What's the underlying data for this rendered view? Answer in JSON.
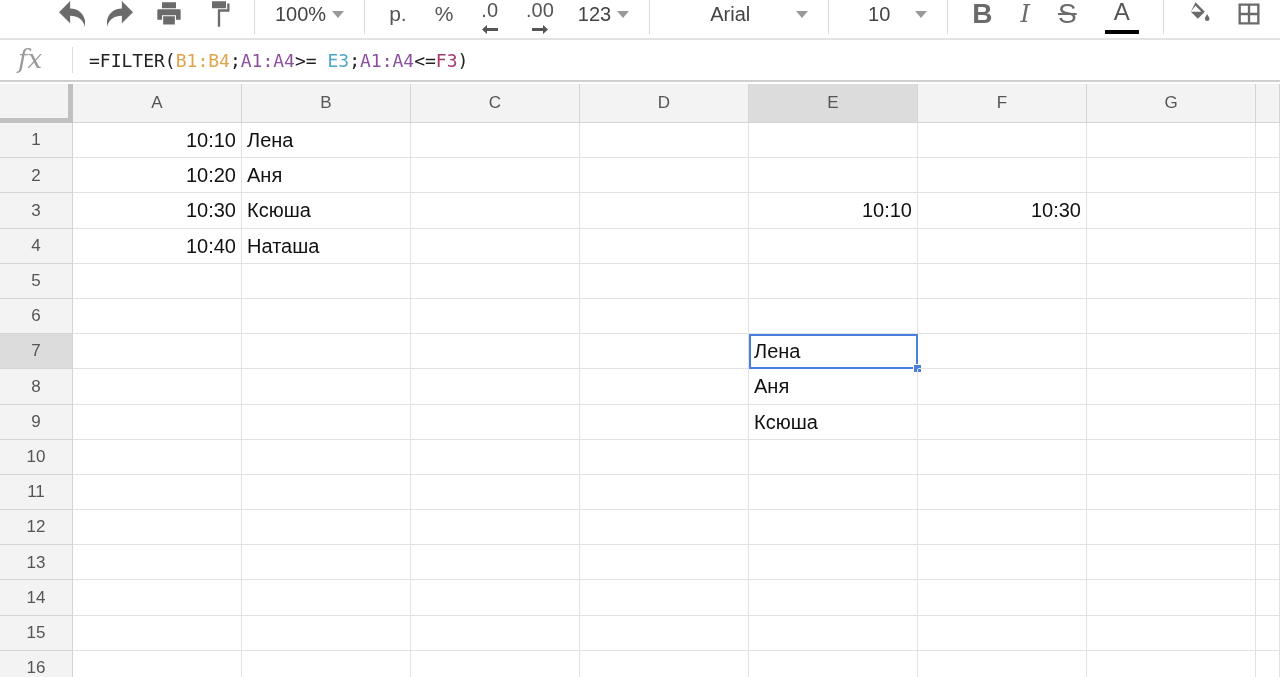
{
  "toolbar": {
    "groups": [
      [
        {
          "kind": "undo"
        },
        {
          "kind": "redo"
        },
        {
          "kind": "print"
        },
        {
          "kind": "paint-format"
        }
      ],
      [
        {
          "kind": "dropdown",
          "label": "100%"
        }
      ],
      [
        {
          "kind": "text",
          "label": "р."
        },
        {
          "kind": "text",
          "label": "%"
        },
        {
          "kind": "decimal-less",
          "label": ".0"
        },
        {
          "kind": "decimal-more",
          "label": ".00"
        },
        {
          "kind": "dropdown",
          "label": "123"
        }
      ],
      [
        {
          "kind": "font-dropdown",
          "label": "Arial"
        }
      ],
      [
        {
          "kind": "size-dropdown",
          "label": "10"
        }
      ],
      [
        {
          "kind": "bold",
          "label": "B"
        },
        {
          "kind": "italic",
          "label": "I"
        },
        {
          "kind": "strike",
          "label": "S"
        },
        {
          "kind": "text-color",
          "label": "A",
          "color": "#000000"
        }
      ],
      [
        {
          "kind": "fill"
        },
        {
          "kind": "borders"
        }
      ]
    ]
  },
  "formula_bar": {
    "label": "fx",
    "parts": [
      {
        "text": "=FILTER("
      },
      {
        "text": "B1:B4",
        "color": "#e0a44a"
      },
      {
        "text": ";"
      },
      {
        "text": "A1:A4",
        "color": "#8c4f9e"
      },
      {
        "text": ">= "
      },
      {
        "text": "E3",
        "color": "#4ea6c8"
      },
      {
        "text": ";"
      },
      {
        "text": "A1:A4",
        "color": "#8c4f9e"
      },
      {
        "text": "<="
      },
      {
        "text": "F3",
        "color": "#a3386f"
      },
      {
        "text": ")"
      }
    ]
  },
  "columns": [
    {
      "label": "A",
      "selected": false
    },
    {
      "label": "B",
      "selected": false
    },
    {
      "label": "C",
      "selected": false
    },
    {
      "label": "D",
      "selected": false
    },
    {
      "label": "E",
      "selected": true
    },
    {
      "label": "F",
      "selected": false
    },
    {
      "label": "G",
      "selected": false
    }
  ],
  "rows": [
    {
      "label": "1",
      "selected": false,
      "cells": [
        {
          "kind": "number",
          "text": "10:10",
          "selected": false
        },
        {
          "kind": "text",
          "text": "Лена",
          "selected": false
        },
        {
          "selected": false
        },
        {
          "selected": false
        },
        {
          "selected": false
        },
        {
          "selected": false
        },
        {
          "selected": false
        }
      ]
    },
    {
      "label": "2",
      "selected": false,
      "cells": [
        {
          "kind": "number",
          "text": "10:20",
          "selected": false
        },
        {
          "kind": "text",
          "text": "Аня",
          "selected": false
        },
        {
          "selected": false
        },
        {
          "selected": false
        },
        {
          "selected": false
        },
        {
          "selected": false
        },
        {
          "selected": false
        }
      ]
    },
    {
      "label": "3",
      "selected": false,
      "cells": [
        {
          "kind": "number",
          "text": "10:30",
          "selected": false
        },
        {
          "kind": "text",
          "text": "Ксюша",
          "selected": false
        },
        {
          "selected": false
        },
        {
          "selected": false
        },
        {
          "kind": "number",
          "text": "10:10",
          "selected": false
        },
        {
          "kind": "number",
          "text": "10:30",
          "selected": false
        },
        {
          "selected": false
        }
      ]
    },
    {
      "label": "4",
      "selected": false,
      "cells": [
        {
          "kind": "number",
          "text": "10:40",
          "selected": false
        },
        {
          "kind": "text",
          "text": "Наташа",
          "selected": false
        },
        {
          "selected": false
        },
        {
          "selected": false
        },
        {
          "selected": false
        },
        {
          "selected": false
        },
        {
          "selected": false
        }
      ]
    },
    {
      "label": "5",
      "selected": false,
      "cells": [
        {
          "selected": false
        },
        {
          "selected": false
        },
        {
          "selected": false
        },
        {
          "selected": false
        },
        {
          "selected": false
        },
        {
          "selected": false
        },
        {
          "selected": false
        }
      ]
    },
    {
      "label": "6",
      "selected": false,
      "cells": [
        {
          "selected": false
        },
        {
          "selected": false
        },
        {
          "selected": false
        },
        {
          "selected": false
        },
        {
          "selected": false
        },
        {
          "selected": false
        },
        {
          "selected": false
        }
      ]
    },
    {
      "label": "7",
      "selected": true,
      "cells": [
        {
          "selected": false
        },
        {
          "selected": false
        },
        {
          "selected": false
        },
        {
          "selected": false
        },
        {
          "kind": "text",
          "text": "Лена",
          "selected": true
        },
        {
          "selected": false
        },
        {
          "selected": false
        }
      ]
    },
    {
      "label": "8",
      "selected": false,
      "cells": [
        {
          "selected": false
        },
        {
          "selected": false
        },
        {
          "selected": false
        },
        {
          "selected": false
        },
        {
          "kind": "text",
          "text": "Аня",
          "selected": false
        },
        {
          "selected": false
        },
        {
          "selected": false
        }
      ]
    },
    {
      "label": "9",
      "selected": false,
      "cells": [
        {
          "selected": false
        },
        {
          "selected": false
        },
        {
          "selected": false
        },
        {
          "selected": false
        },
        {
          "kind": "text",
          "text": "Ксюша",
          "selected": false
        },
        {
          "selected": false
        },
        {
          "selected": false
        }
      ]
    },
    {
      "label": "10",
      "selected": false,
      "cells": [
        {
          "selected": false
        },
        {
          "selected": false
        },
        {
          "selected": false
        },
        {
          "selected": false
        },
        {
          "selected": false
        },
        {
          "selected": false
        },
        {
          "selected": false
        }
      ]
    },
    {
      "label": "11",
      "selected": false,
      "cells": [
        {
          "selected": false
        },
        {
          "selected": false
        },
        {
          "selected": false
        },
        {
          "selected": false
        },
        {
          "selected": false
        },
        {
          "selected": false
        },
        {
          "selected": false
        }
      ]
    },
    {
      "label": "12",
      "selected": false,
      "cells": [
        {
          "selected": false
        },
        {
          "selected": false
        },
        {
          "selected": false
        },
        {
          "selected": false
        },
        {
          "selected": false
        },
        {
          "selected": false
        },
        {
          "selected": false
        }
      ]
    },
    {
      "label": "13",
      "selected": false,
      "cells": [
        {
          "selected": false
        },
        {
          "selected": false
        },
        {
          "selected": false
        },
        {
          "selected": false
        },
        {
          "selected": false
        },
        {
          "selected": false
        },
        {
          "selected": false
        }
      ]
    },
    {
      "label": "14",
      "selected": false,
      "cells": [
        {
          "selected": false
        },
        {
          "selected": false
        },
        {
          "selected": false
        },
        {
          "selected": false
        },
        {
          "selected": false
        },
        {
          "selected": false
        },
        {
          "selected": false
        }
      ]
    },
    {
      "label": "15",
      "selected": false,
      "cells": [
        {
          "selected": false
        },
        {
          "selected": false
        },
        {
          "selected": false
        },
        {
          "selected": false
        },
        {
          "selected": false
        },
        {
          "selected": false
        },
        {
          "selected": false
        }
      ]
    },
    {
      "label": "16",
      "selected": false,
      "cells": [
        {
          "selected": false
        },
        {
          "selected": false
        },
        {
          "selected": false
        },
        {
          "selected": false
        },
        {
          "selected": false
        },
        {
          "selected": false
        },
        {
          "selected": false
        }
      ]
    }
  ]
}
